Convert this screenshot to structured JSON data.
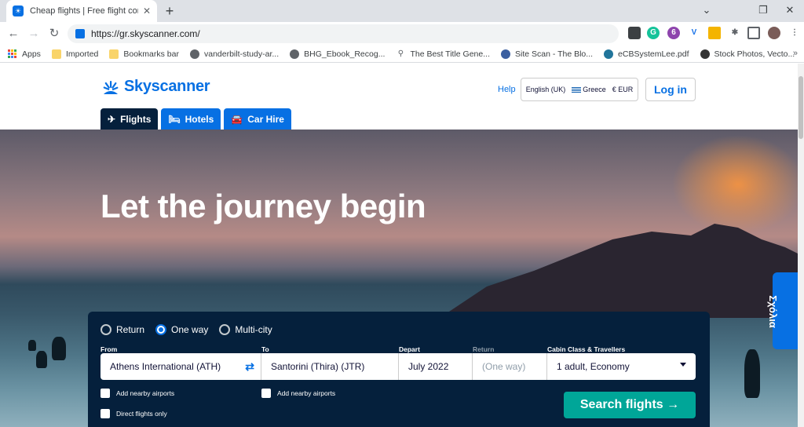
{
  "browser": {
    "tab": {
      "title": "Cheap flights | Free flight compari",
      "close": "✕"
    },
    "new_tab": "+",
    "window": {
      "minimize": "⌄",
      "restore": "❐",
      "close": "✕"
    },
    "nav": {
      "back": "←",
      "forward": "→",
      "reload": "↻"
    },
    "url": "https://gr.skyscanner.com/",
    "bookmarks": [
      {
        "label": "Apps"
      },
      {
        "label": "Imported"
      },
      {
        "label": "Bookmarks bar"
      },
      {
        "label": "vanderbilt-study-ar..."
      },
      {
        "label": "BHG_Ebook_Recog..."
      },
      {
        "label": "The Best Title Gene..."
      },
      {
        "label": "Site Scan - The Blo..."
      },
      {
        "label": "eCBSystemLee.pdf"
      },
      {
        "label": "Stock Photos, Vecto..."
      }
    ],
    "bookmarks_more": "»"
  },
  "header": {
    "brand": "Skyscanner",
    "help": "Help",
    "locale": {
      "language": "English (UK)",
      "country": "Greece",
      "currency": "€ EUR"
    },
    "login": "Log in",
    "tabs": [
      {
        "label": "Flights",
        "icon": "✈"
      },
      {
        "label": "Hotels",
        "icon": "🛏"
      },
      {
        "label": "Car Hire",
        "icon": "🚘"
      }
    ]
  },
  "hero": {
    "title": "Let the journey begin"
  },
  "feedback_tab": "Σχόλια",
  "search": {
    "trip_types": [
      {
        "label": "Return",
        "selected": false
      },
      {
        "label": "One way",
        "selected": true
      },
      {
        "label": "Multi-city",
        "selected": false
      }
    ],
    "labels": {
      "from": "From",
      "to": "To",
      "depart": "Depart",
      "return": "Return",
      "cabin": "Cabin Class & Travellers"
    },
    "from_value": "Athens International (ATH)",
    "to_value": "Santorini (Thira) (JTR)",
    "depart_value": "July 2022",
    "return_placeholder": "(One way)",
    "cabin_value": "1 adult, Economy",
    "swap_icon": "⇄",
    "nearby_from": "Add nearby airports",
    "nearby_to": "Add nearby airports",
    "direct_only": "Direct flights only",
    "submit": "Search flights →"
  },
  "colors": {
    "brand_blue": "#0770e3",
    "navy": "#05203c",
    "search_green": "#00a698"
  }
}
